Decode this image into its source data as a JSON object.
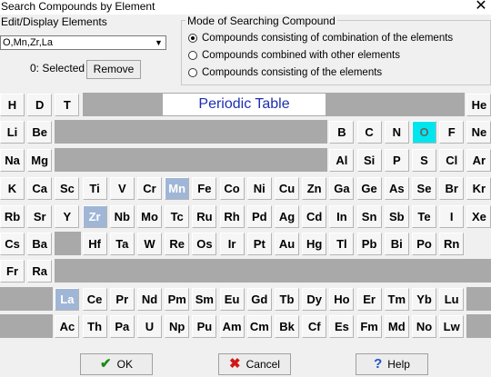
{
  "window": {
    "title": "Search Compounds by Element"
  },
  "edit": {
    "label": "Edit/Display Elements",
    "value": "O,Mn,Zr,La"
  },
  "selection": {
    "count_text": "0: Selected",
    "remove_label": "Remove"
  },
  "mode": {
    "legend": "Mode of Searching Compound",
    "options": [
      {
        "label": "Compounds consisting of combination of the elements",
        "selected": true
      },
      {
        "label": "Compounds combined with other elements",
        "selected": false
      },
      {
        "label": "Compounds consisting of the elements",
        "selected": false
      }
    ]
  },
  "periodic_table": {
    "title": "Periodic Table",
    "rows": [
      [
        "H",
        "D",
        "T",
        "He"
      ],
      [
        "Li",
        "Be",
        "B",
        "C",
        "N",
        "O",
        "F",
        "Ne"
      ],
      [
        "Na",
        "Mg",
        "Al",
        "Si",
        "P",
        "S",
        "Cl",
        "Ar"
      ],
      [
        "K",
        "Ca",
        "Sc",
        "Ti",
        "V",
        "Cr",
        "Mn",
        "Fe",
        "Co",
        "Ni",
        "Cu",
        "Zn",
        "Ga",
        "Ge",
        "As",
        "Se",
        "Br",
        "Kr"
      ],
      [
        "Rb",
        "Sr",
        "Y",
        "Zr",
        "Nb",
        "Mo",
        "Tc",
        "Ru",
        "Rh",
        "Pd",
        "Ag",
        "Cd",
        "In",
        "Sn",
        "Sb",
        "Te",
        "I",
        "Xe"
      ],
      [
        "Cs",
        "Ba",
        "Hf",
        "Ta",
        "W",
        "Re",
        "Os",
        "Ir",
        "Pt",
        "Au",
        "Hg",
        "Tl",
        "Pb",
        "Bi",
        "Po",
        "Rn"
      ],
      [
        "Fr",
        "Ra"
      ],
      [
        "La",
        "Ce",
        "Pr",
        "Nd",
        "Pm",
        "Sm",
        "Eu",
        "Gd",
        "Tb",
        "Dy",
        "Ho",
        "Er",
        "Tm",
        "Yb",
        "Lu"
      ],
      [
        "Ac",
        "Th",
        "Pa",
        "U",
        "Np",
        "Pu",
        "Am",
        "Cm",
        "Bk",
        "Cf",
        "Es",
        "Fm",
        "Md",
        "No",
        "Lw"
      ]
    ],
    "highlighted": {
      "O": "#00e6ee",
      "Mn": "#9fb6d6",
      "Zr": "#9fb6d6",
      "La": "#9fb6d6"
    }
  },
  "buttons": {
    "ok": "OK",
    "cancel": "Cancel",
    "help": "Help"
  }
}
